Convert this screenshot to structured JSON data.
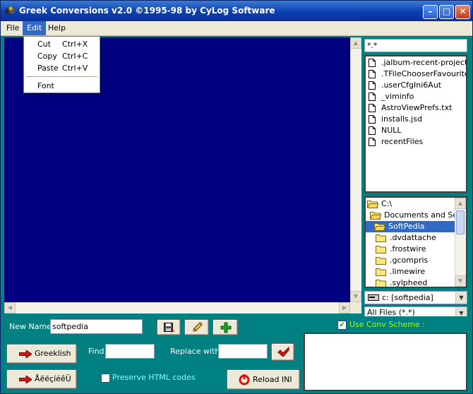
{
  "window": {
    "title": "Greek Conversions v2.0 ©1995-98 by CyLog Software",
    "controls": {
      "minimize": "–",
      "maximize": "□",
      "close": "✕"
    }
  },
  "menubar": {
    "file": "File",
    "edit": "Edit",
    "help": "Help"
  },
  "edit_menu": {
    "items": [
      {
        "label": "Cut",
        "shortcut": "Ctrl+X"
      },
      {
        "label": "Copy",
        "shortcut": "Ctrl+C"
      },
      {
        "label": "Paste",
        "shortcut": "Ctrl+V"
      },
      {
        "label": "Font",
        "shortcut": ""
      }
    ]
  },
  "file_panel": {
    "mask": "*.*",
    "files": [
      ".jalbum-recent-projects.pro",
      ".TFileChooserFavourites",
      ".userCfgIni6Aut",
      "_viminfo",
      "AstroViewPrefs.txt",
      "installs.jsd",
      "NULL",
      "recentFiles"
    ],
    "directories": [
      {
        "name": "C:\\",
        "level": 0,
        "selected": false,
        "open": true
      },
      {
        "name": "Documents and Settings",
        "level": 1,
        "selected": false,
        "open": true
      },
      {
        "name": "SoftPedia",
        "level": 2,
        "selected": true,
        "open": true
      },
      {
        "name": ".dvdattache",
        "level": 3,
        "selected": false,
        "open": false
      },
      {
        "name": ".frostwire",
        "level": 3,
        "selected": false,
        "open": false
      },
      {
        "name": ".gcompris",
        "level": 3,
        "selected": false,
        "open": false
      },
      {
        "name": ".limewire",
        "level": 3,
        "selected": false,
        "open": false
      },
      {
        "name": ".sylpheed",
        "level": 3,
        "selected": false,
        "open": false
      }
    ],
    "drive": "c: [softpedia]",
    "filter": "All Files (*.*)"
  },
  "bottom": {
    "new_name_label": "New Name",
    "new_name_value": "softpedia",
    "use_conv_scheme_label": "Use Conv Scheme :",
    "use_conv_scheme_checked": true,
    "greeklish_button": "Greeklish",
    "greek_button": "ÅëëçíéêÜ",
    "find_label": "Find",
    "find_value": "",
    "replace_label": "Replace with",
    "replace_value": "",
    "preserve_html_label": "Preserve HTML codes",
    "preserve_html_checked": false,
    "reload_button": "Reload INI"
  },
  "colors": {
    "window_bg": "#008080",
    "editor_bg": "#000080",
    "title_bar": "#0a3fb0",
    "menu_highlight": "#316ac5",
    "label_green": "#a8ff00",
    "label_cyan": "#7fffff"
  }
}
